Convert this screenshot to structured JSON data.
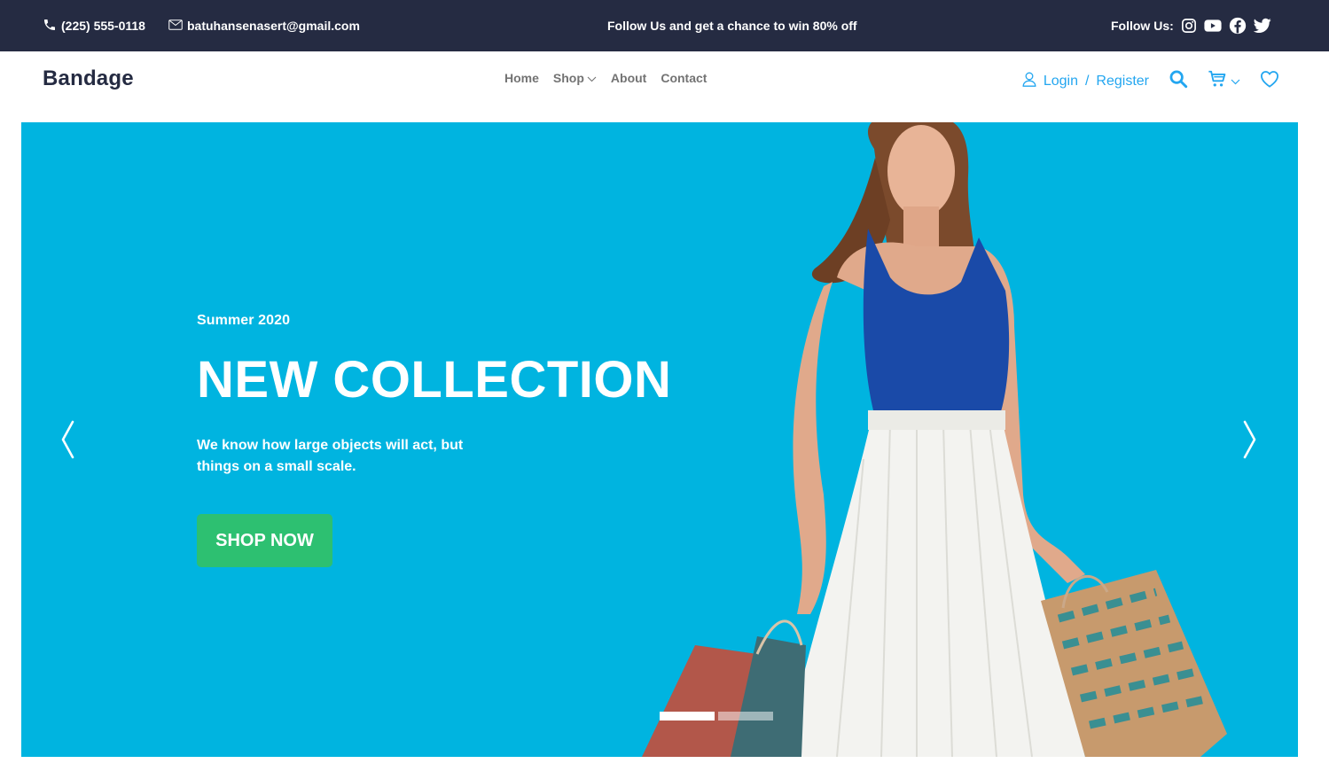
{
  "topbar": {
    "phone": "(225) 555-0118",
    "email": "batuhansenasert@gmail.com",
    "promo": "Follow Us and get a chance to win 80% off",
    "follow_label": "Follow Us:",
    "social_icons": [
      "instagram-icon",
      "youtube-icon",
      "facebook-icon",
      "twitter-icon"
    ]
  },
  "navbar": {
    "brand": "Bandage",
    "links": [
      {
        "label": "Home"
      },
      {
        "label": "Shop",
        "has_dropdown": true
      },
      {
        "label": "About"
      },
      {
        "label": "Contact"
      }
    ],
    "login": "Login",
    "separator": "/",
    "register": "Register",
    "icons": [
      "user-icon",
      "search-icon",
      "cart-icon",
      "chevron-down-icon",
      "heart-icon"
    ]
  },
  "hero": {
    "season": "Summer 2020",
    "headline": "NEW COLLECTION",
    "subtext": "We know how large objects will act, but things on a small scale.",
    "button": "SHOP NOW",
    "slides_total": 2,
    "active_slide": 1
  },
  "colors": {
    "topbar_bg": "#252b42",
    "hero_bg": "#00b4e0",
    "accent_blue": "#23a6f0",
    "button_green": "#2dc071",
    "nav_text": "#737373"
  }
}
